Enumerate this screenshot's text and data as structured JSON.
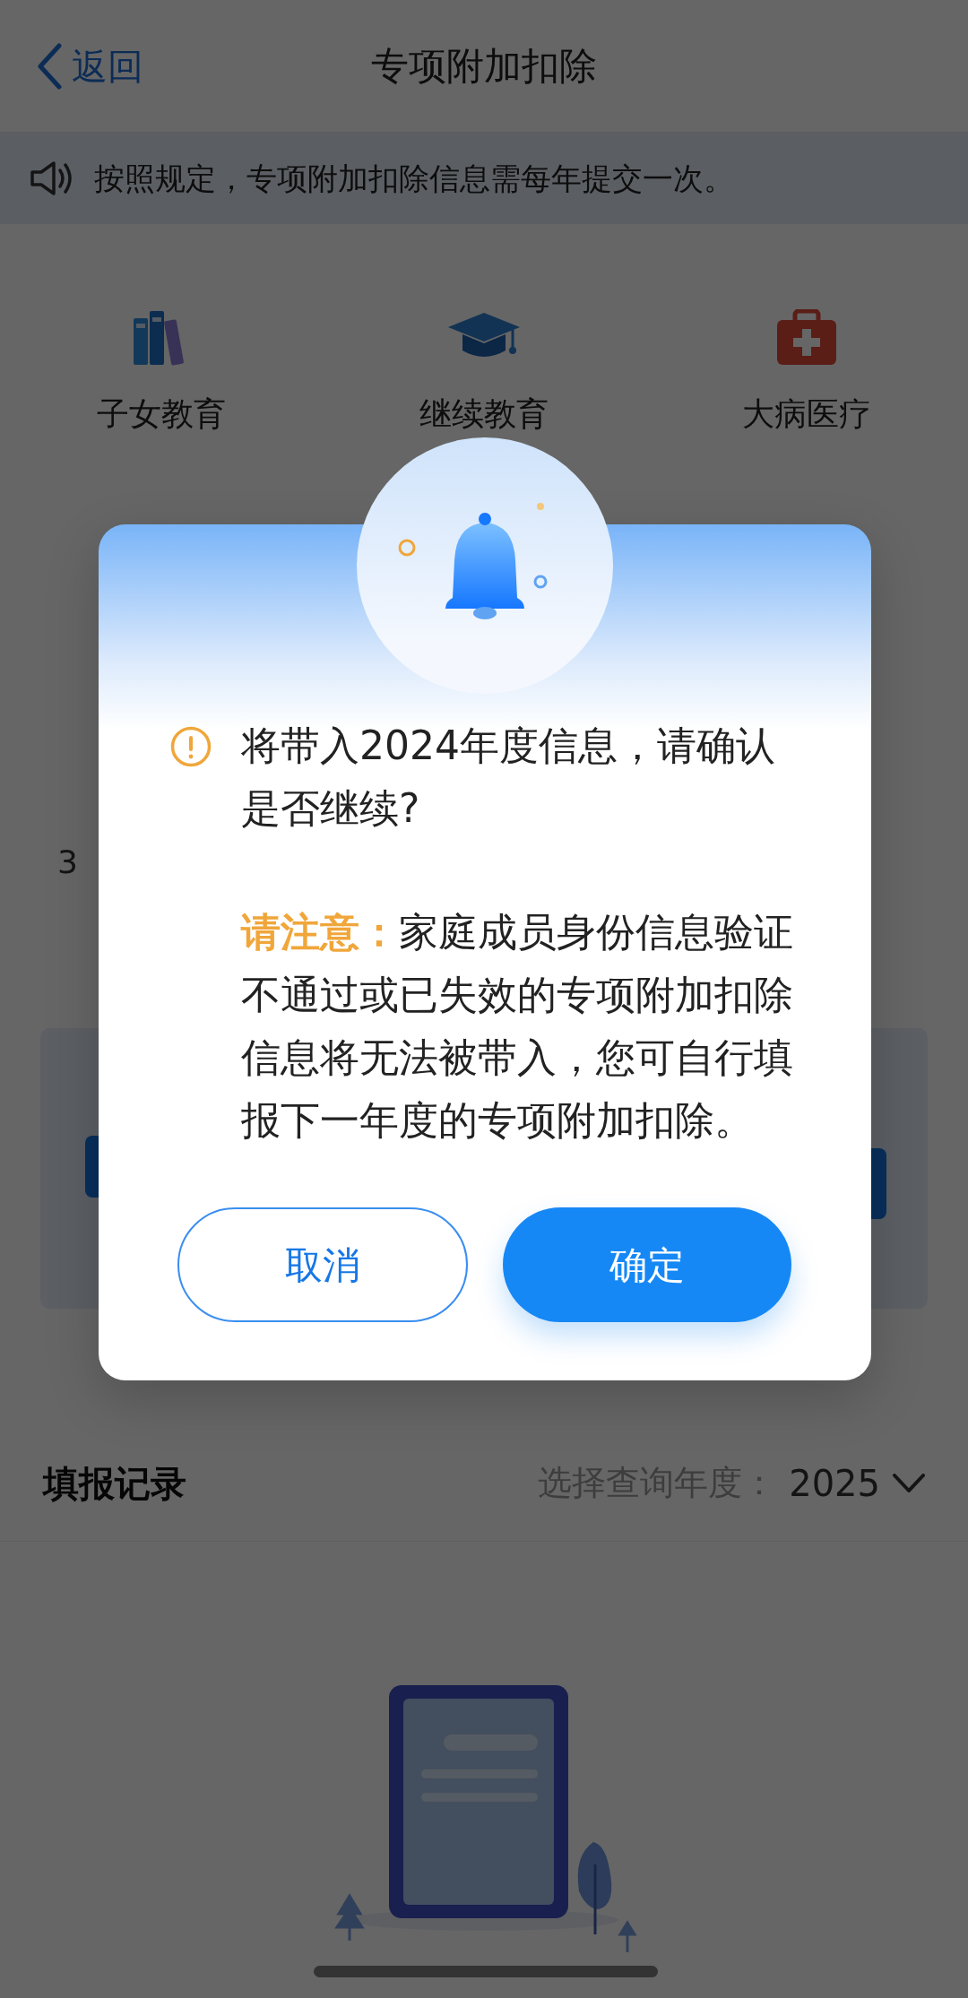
{
  "nav": {
    "back": "返回",
    "title": "专项附加扣除"
  },
  "notice": "按照规定，专项附加扣除信息需每年提交一次。",
  "categories": [
    {
      "label": "子女教育",
      "kind": "books"
    },
    {
      "label": "继续教育",
      "kind": "cap"
    },
    {
      "label": "大病医疗",
      "kind": "medkit"
    }
  ],
  "covered_fragment": "3",
  "records": {
    "title": "填报记录",
    "year_label": "选择查询年度：",
    "year": "2025"
  },
  "dialog": {
    "message": "将带入2024年度信息，请确认是否继续?",
    "note_label": "请注意：",
    "note": "家庭成员身份信息验证不通过或已失效的专项附加扣除信息将无法被带入，您可自行填报下一年度的专项附加扣除。",
    "buttons": [
      {
        "label": "取消",
        "kind": "secondary"
      },
      {
        "label": "确定",
        "kind": "primary"
      }
    ]
  }
}
